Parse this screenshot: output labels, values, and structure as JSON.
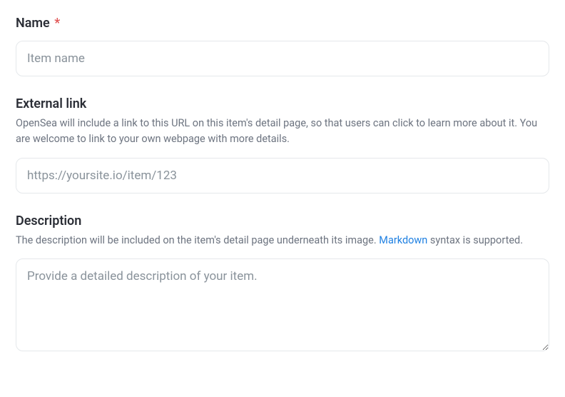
{
  "name_field": {
    "label": "Name",
    "required_indicator": "*",
    "placeholder": "Item name",
    "value": ""
  },
  "external_link_field": {
    "label": "External link",
    "help_text": "OpenSea will include a link to this URL on this item's detail page, so that users can click to learn more about it. You are welcome to link to your own webpage with more details.",
    "placeholder": "https://yoursite.io/item/123",
    "value": ""
  },
  "description_field": {
    "label": "Description",
    "help_text_before": "The description will be included on the item's detail page underneath its image. ",
    "help_link_text": "Markdown",
    "help_text_after": " syntax is supported.",
    "placeholder": "Provide a detailed description of your item.",
    "value": ""
  }
}
